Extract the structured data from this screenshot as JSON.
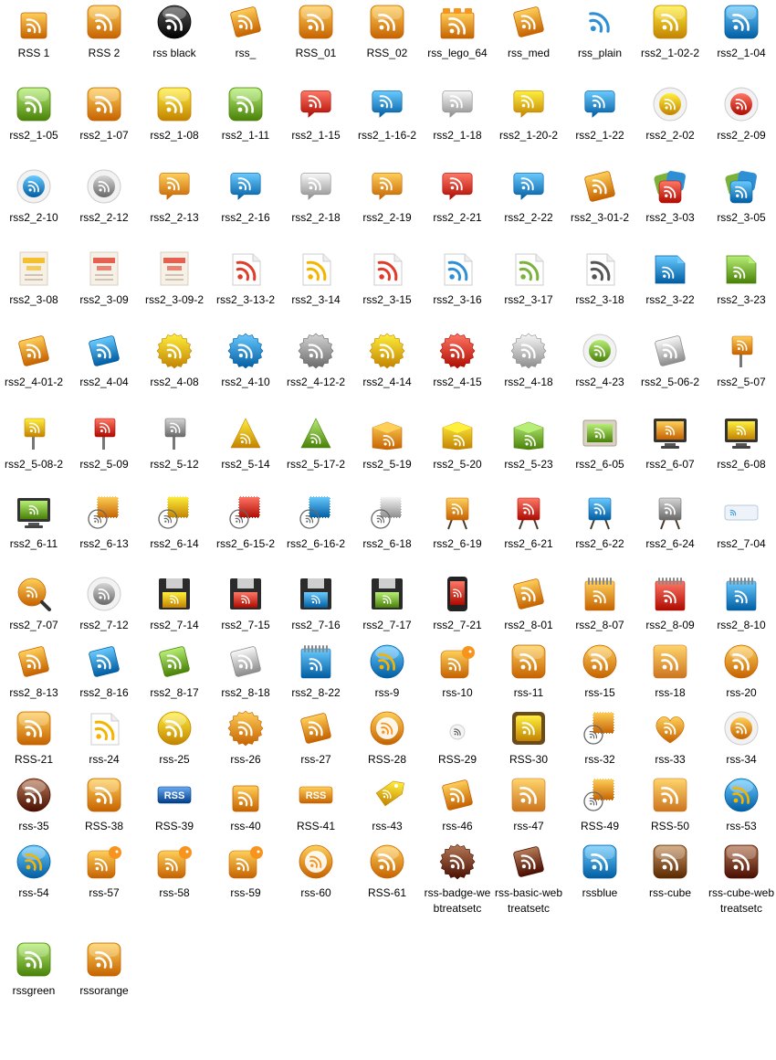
{
  "window": {
    "title": "",
    "view_mode": "large-icons"
  },
  "colors": {
    "rss_orange": "#f7941d",
    "rss_red": "#e03c2a",
    "rss_yellow": "#f4b400",
    "rss_blue": "#2e8fd4",
    "rss_green": "#7bb33a",
    "rss_gray": "#9a9a9a",
    "rss_black": "#1a1a1a",
    "rss_brown": "#7a3f1c",
    "selection_bg": "#cce8ff",
    "label_text": "#000000"
  },
  "rows": [
    [
      {
        "name": "RSS 1",
        "icon": "rss-icon",
        "color": "#f7941d",
        "shape": "square"
      },
      {
        "name": "RSS 2",
        "icon": "rss-icon",
        "color": "#f7941d",
        "shape": "rounded"
      },
      {
        "name": "rss black",
        "icon": "rss-icon",
        "color": "#1a1a1a",
        "shape": "circle"
      },
      {
        "name": "rss_",
        "icon": "rss-icon",
        "color": "#f7941d",
        "shape": "tilted"
      },
      {
        "name": "RSS_01",
        "icon": "rss-icon",
        "color": "#f7941d",
        "shape": "rounded"
      },
      {
        "name": "RSS_02",
        "icon": "rss-icon",
        "color": "#f7941d",
        "shape": "rounded"
      },
      {
        "name": "rss_lego_64",
        "icon": "rss-icon",
        "color": "#f7941d",
        "shape": "lego"
      },
      {
        "name": "rss_med",
        "icon": "rss-icon",
        "color": "#f7941d",
        "shape": "tilted"
      },
      {
        "name": "rss_plain",
        "icon": "rss-icon",
        "color": "#2e8fd4",
        "shape": "plain"
      },
      {
        "name": "rss2_1-02-2",
        "icon": "rss-icon",
        "color": "#f4b400",
        "shape": "rounded"
      },
      {
        "name": "rss2_1-04",
        "icon": "rss-icon",
        "color": "#2e8fd4",
        "shape": "rounded"
      }
    ],
    [
      {
        "name": "rss2_1-05",
        "icon": "rss-icon",
        "color": "#7bb33a",
        "shape": "rounded"
      },
      {
        "name": "rss2_1-07",
        "icon": "rss-icon",
        "color": "#f7941d",
        "shape": "rounded"
      },
      {
        "name": "rss2_1-08",
        "icon": "rss-icon",
        "color": "#f4b400",
        "shape": "rounded"
      },
      {
        "name": "rss2_1-11",
        "icon": "rss-icon",
        "color": "#7bb33a",
        "shape": "rounded"
      },
      {
        "name": "rss2_1-15",
        "icon": "rss-icon",
        "color": "#e03c2a",
        "shape": "bubble"
      },
      {
        "name": "rss2_1-16-2",
        "icon": "rss-icon",
        "color": "#2e8fd4",
        "shape": "bubble"
      },
      {
        "name": "rss2_1-18",
        "icon": "rss-icon",
        "color": "#bdbdbd",
        "shape": "bubble"
      },
      {
        "name": "rss2_1-20-2",
        "icon": "rss-icon",
        "color": "#f4b400",
        "shape": "bubble"
      },
      {
        "name": "rss2_1-22",
        "icon": "rss-icon",
        "color": "#2e8fd4",
        "shape": "bubble"
      },
      {
        "name": "rss2_2-02",
        "icon": "rss-icon",
        "color": "#f4b400",
        "shape": "button"
      },
      {
        "name": "rss2_2-09",
        "icon": "rss-icon",
        "color": "#e03c2a",
        "shape": "button"
      }
    ],
    [
      {
        "name": "rss2_2-10",
        "icon": "rss-icon",
        "color": "#2e8fd4",
        "shape": "button"
      },
      {
        "name": "rss2_2-12",
        "icon": "rss-icon",
        "color": "#9a9a9a",
        "shape": "button"
      },
      {
        "name": "rss2_2-13",
        "icon": "rss-icon",
        "color": "#f7941d",
        "shape": "bubble"
      },
      {
        "name": "rss2_2-16",
        "icon": "rss-icon",
        "color": "#2e8fd4",
        "shape": "bubble"
      },
      {
        "name": "rss2_2-18",
        "icon": "rss-icon",
        "color": "#bdbdbd",
        "shape": "bubble"
      },
      {
        "name": "rss2_2-19",
        "icon": "rss-icon",
        "color": "#f7941d",
        "shape": "bubble"
      },
      {
        "name": "rss2_2-21",
        "icon": "rss-icon",
        "color": "#e03c2a",
        "shape": "bubble"
      },
      {
        "name": "rss2_2-22",
        "icon": "rss-icon",
        "color": "#2e8fd4",
        "shape": "bubble"
      },
      {
        "name": "rss2_3-01-2",
        "icon": "rss-icon",
        "color": "#f7941d",
        "shape": "tilted"
      },
      {
        "name": "rss2_3-03",
        "icon": "rss-icon",
        "color": "#e03c2a",
        "shape": "stack"
      },
      {
        "name": "rss2_3-05",
        "icon": "rss-icon",
        "color": "#2e8fd4",
        "shape": "stack"
      }
    ],
    [
      {
        "name": "rss2_3-08",
        "icon": "rss-icon",
        "color": "#f4b400",
        "shape": "subscribe"
      },
      {
        "name": "rss2_3-09",
        "icon": "rss-icon",
        "color": "#e03c2a",
        "shape": "subscribe"
      },
      {
        "name": "rss2_3-09-2",
        "icon": "rss-icon",
        "color": "#e03c2a",
        "shape": "subscribe"
      },
      {
        "name": "rss2_3-13-2",
        "icon": "rss-icon",
        "color": "#e03c2a",
        "shape": "paper"
      },
      {
        "name": "rss2_3-14",
        "icon": "rss-icon",
        "color": "#f4b400",
        "shape": "paper"
      },
      {
        "name": "rss2_3-15",
        "icon": "rss-icon",
        "color": "#e03c2a",
        "shape": "paper"
      },
      {
        "name": "rss2_3-16",
        "icon": "rss-icon",
        "color": "#2e8fd4",
        "shape": "paper"
      },
      {
        "name": "rss2_3-17",
        "icon": "rss-icon",
        "color": "#7bb33a",
        "shape": "paper"
      },
      {
        "name": "rss2_3-18",
        "icon": "rss-icon",
        "color": "#555555",
        "shape": "paper"
      },
      {
        "name": "rss2_3-22",
        "icon": "rss-icon",
        "color": "#2e8fd4",
        "shape": "page"
      },
      {
        "name": "rss2_3-23",
        "icon": "rss-icon",
        "color": "#7bb33a",
        "shape": "page"
      }
    ],
    [
      {
        "name": "rss2_4-01-2",
        "icon": "rss-icon",
        "color": "#f7941d",
        "shape": "tilted"
      },
      {
        "name": "rss2_4-04",
        "icon": "rss-icon",
        "color": "#2e8fd4",
        "shape": "tilted"
      },
      {
        "name": "rss2_4-08",
        "icon": "rss-icon",
        "color": "#f4b400",
        "shape": "badge"
      },
      {
        "name": "rss2_4-10",
        "icon": "rss-icon",
        "color": "#2e8fd4",
        "shape": "badge"
      },
      {
        "name": "rss2_4-12-2",
        "icon": "rss-icon",
        "color": "#9a9a9a",
        "shape": "badge"
      },
      {
        "name": "rss2_4-14",
        "icon": "rss-icon",
        "color": "#f4b400",
        "shape": "badge"
      },
      {
        "name": "rss2_4-15",
        "icon": "rss-icon",
        "color": "#e03c2a",
        "shape": "badge"
      },
      {
        "name": "rss2_4-18",
        "icon": "rss-icon",
        "color": "#bdbdbd",
        "shape": "badge"
      },
      {
        "name": "rss2_4-23",
        "icon": "rss-icon",
        "color": "#7bb33a",
        "shape": "button"
      },
      {
        "name": "rss2_5-06-2",
        "icon": "rss-icon",
        "color": "#bdbdbd",
        "shape": "tilted"
      },
      {
        "name": "rss2_5-07",
        "icon": "rss-icon",
        "color": "#f7941d",
        "shape": "sign"
      }
    ],
    [
      {
        "name": "rss2_5-08-2",
        "icon": "rss-icon",
        "color": "#f4b400",
        "shape": "sign"
      },
      {
        "name": "rss2_5-09",
        "icon": "rss-icon",
        "color": "#e03c2a",
        "shape": "sign"
      },
      {
        "name": "rss2_5-12",
        "icon": "rss-icon",
        "color": "#9a9a9a",
        "shape": "sign"
      },
      {
        "name": "rss2_5-14",
        "icon": "rss-icon",
        "color": "#f4b400",
        "shape": "tent"
      },
      {
        "name": "rss2_5-17-2",
        "icon": "rss-icon",
        "color": "#7bb33a",
        "shape": "tent"
      },
      {
        "name": "rss2_5-19",
        "icon": "rss-icon",
        "color": "#f7941d",
        "shape": "box"
      },
      {
        "name": "rss2_5-20",
        "icon": "rss-icon",
        "color": "#f4b400",
        "shape": "box"
      },
      {
        "name": "rss2_5-23",
        "icon": "rss-icon",
        "color": "#7bb33a",
        "shape": "box"
      },
      {
        "name": "rss2_6-05",
        "icon": "rss-icon",
        "color": "#7bb33a",
        "shape": "frame"
      },
      {
        "name": "rss2_6-07",
        "icon": "rss-icon",
        "color": "#f7941d",
        "shape": "monitor"
      },
      {
        "name": "rss2_6-08",
        "icon": "rss-icon",
        "color": "#f4b400",
        "shape": "monitor"
      }
    ],
    [
      {
        "name": "rss2_6-11",
        "icon": "rss-icon",
        "color": "#7bb33a",
        "shape": "monitor"
      },
      {
        "name": "rss2_6-13",
        "icon": "rss-icon",
        "color": "#f7941d",
        "shape": "stamp"
      },
      {
        "name": "rss2_6-14",
        "icon": "rss-icon",
        "color": "#f4b400",
        "shape": "stamp"
      },
      {
        "name": "rss2_6-15-2",
        "icon": "rss-icon",
        "color": "#e03c2a",
        "shape": "stamp"
      },
      {
        "name": "rss2_6-16-2",
        "icon": "rss-icon",
        "color": "#2e8fd4",
        "shape": "stamp"
      },
      {
        "name": "rss2_6-18",
        "icon": "rss-icon",
        "color": "#bdbdbd",
        "shape": "stamp"
      },
      {
        "name": "rss2_6-19",
        "icon": "rss-icon",
        "color": "#f7941d",
        "shape": "easel"
      },
      {
        "name": "rss2_6-21",
        "icon": "rss-icon",
        "color": "#e03c2a",
        "shape": "easel"
      },
      {
        "name": "rss2_6-22",
        "icon": "rss-icon",
        "color": "#2e8fd4",
        "shape": "easel"
      },
      {
        "name": "rss2_6-24",
        "icon": "rss-icon",
        "color": "#9a9a9a",
        "shape": "easel"
      },
      {
        "name": "rss2_7-04",
        "icon": "rss-icon",
        "color": "#2e8fd4",
        "shape": "ticket"
      }
    ],
    [
      {
        "name": "rss2_7-07",
        "icon": "rss-icon",
        "color": "#f7941d",
        "shape": "magnifier"
      },
      {
        "name": "rss2_7-12",
        "icon": "rss-icon",
        "color": "#9a9a9a",
        "shape": "button"
      },
      {
        "name": "rss2_7-14",
        "icon": "rss-icon",
        "color": "#f4b400",
        "shape": "floppy"
      },
      {
        "name": "rss2_7-15",
        "icon": "rss-icon",
        "color": "#e03c2a",
        "shape": "floppy"
      },
      {
        "name": "rss2_7-16",
        "icon": "rss-icon",
        "color": "#2e8fd4",
        "shape": "floppy"
      },
      {
        "name": "rss2_7-17",
        "icon": "rss-icon",
        "color": "#7bb33a",
        "shape": "floppy"
      },
      {
        "name": "rss2_7-21",
        "icon": "rss-icon",
        "color": "#e03c2a",
        "shape": "phone"
      },
      {
        "name": "rss2_8-01",
        "icon": "rss-icon",
        "color": "#f7941d",
        "shape": "tilted"
      },
      {
        "name": "rss2_8-07",
        "icon": "rss-icon",
        "color": "#f7941d",
        "shape": "notepad"
      },
      {
        "name": "rss2_8-09",
        "icon": "rss-icon",
        "color": "#e03c2a",
        "shape": "notepad"
      },
      {
        "name": "rss2_8-10",
        "icon": "rss-icon",
        "color": "#2e8fd4",
        "shape": "notepad"
      }
    ],
    [
      {
        "name": "rss2_8-13",
        "icon": "rss-icon",
        "color": "#f7941d",
        "shape": "tilted"
      },
      {
        "name": "rss2_8-16",
        "icon": "rss-icon",
        "color": "#2e8fd4",
        "shape": "tilted"
      },
      {
        "name": "rss2_8-17",
        "icon": "rss-icon",
        "color": "#7bb33a",
        "shape": "tilted"
      },
      {
        "name": "rss2_8-18",
        "icon": "rss-icon",
        "color": "#bdbdbd",
        "shape": "tilted"
      },
      {
        "name": "rss2_8-22",
        "icon": "rss-icon",
        "color": "#2e8fd4",
        "shape": "notepad"
      },
      {
        "name": "rss-9",
        "icon": "rss-icon",
        "color": "#2e8fd4",
        "shape": "globe"
      },
      {
        "name": "rss-10",
        "icon": "rss-icon",
        "color": "#f7941d",
        "shape": "bird"
      },
      {
        "name": "rss-11",
        "icon": "rss-icon",
        "color": "#f7941d",
        "shape": "rounded"
      },
      {
        "name": "rss-15",
        "icon": "rss-icon",
        "color": "#f7941d",
        "shape": "circle"
      },
      {
        "name": "rss-18",
        "icon": "rss-icon",
        "color": "#f7941d",
        "shape": "grunge"
      },
      {
        "name": "rss-20",
        "icon": "rss-icon",
        "color": "#f7941d",
        "shape": "circle"
      }
    ],
    [
      {
        "name": "RSS-21",
        "icon": "rss-icon",
        "color": "#f7941d",
        "shape": "rounded"
      },
      {
        "name": "rss-24",
        "icon": "rss-icon",
        "color": "#f4b400",
        "shape": "paper"
      },
      {
        "name": "rss-25",
        "icon": "rss-icon",
        "color": "#f4b400",
        "shape": "circle"
      },
      {
        "name": "rss-26",
        "icon": "rss-icon",
        "color": "#f7941d",
        "shape": "badge"
      },
      {
        "name": "rss-27",
        "icon": "rss-icon",
        "color": "#f7941d",
        "shape": "tilted"
      },
      {
        "name": "RSS-28",
        "icon": "rss-icon",
        "color": "#f7941d",
        "shape": "ring"
      },
      {
        "name": "RSS-29",
        "icon": "rss-icon",
        "color": "#555555",
        "shape": "small"
      },
      {
        "name": "RSS-30",
        "icon": "rss-icon",
        "color": "#f4b400",
        "shape": "framed"
      },
      {
        "name": "rss-32",
        "icon": "rss-icon",
        "color": "#f7941d",
        "shape": "stamp"
      },
      {
        "name": "rss-33",
        "icon": "rss-icon",
        "color": "#f7941d",
        "shape": "heart"
      },
      {
        "name": "rss-34",
        "icon": "rss-icon",
        "color": "#f7941d",
        "shape": "button"
      }
    ],
    [
      {
        "name": "rss-35",
        "icon": "rss-icon",
        "color": "#7a3f1c",
        "shape": "circle"
      },
      {
        "name": "RSS-38",
        "icon": "rss-icon",
        "color": "#f7941d",
        "shape": "rounded"
      },
      {
        "name": "RSS-39",
        "icon": "rss-icon",
        "color": "#2e6fb8",
        "shape": "textbutton",
        "text": "RSS"
      },
      {
        "name": "rss-40",
        "icon": "rss-icon",
        "color": "#f7941d",
        "shape": "square"
      },
      {
        "name": "RSS-41",
        "icon": "rss-icon",
        "color": "#f7941d",
        "shape": "textbutton",
        "text": "RSS"
      },
      {
        "name": "rss-43",
        "icon": "rss-icon",
        "color": "#f4b400",
        "shape": "tag"
      },
      {
        "name": "rss-46",
        "icon": "rss-icon",
        "color": "#f7941d",
        "shape": "tilted"
      },
      {
        "name": "rss-47",
        "icon": "rss-icon",
        "color": "#f7941d",
        "shape": "grunge"
      },
      {
        "name": "RSS-49",
        "icon": "rss-icon",
        "color": "#f7941d",
        "shape": "stamp"
      },
      {
        "name": "RSS-50",
        "icon": "rss-icon",
        "color": "#f7941d",
        "shape": "grunge"
      },
      {
        "name": "rss-53",
        "icon": "rss-icon",
        "color": "#2e8fd4",
        "shape": "globe"
      }
    ],
    [
      {
        "name": "rss-54",
        "icon": "rss-icon",
        "color": "#2e8fd4",
        "shape": "globe"
      },
      {
        "name": "rss-57",
        "icon": "rss-icon",
        "color": "#f7941d",
        "shape": "bird"
      },
      {
        "name": "rss-58",
        "icon": "rss-icon",
        "color": "#f7941d",
        "shape": "bird"
      },
      {
        "name": "rss-59",
        "icon": "rss-icon",
        "color": "#f7941d",
        "shape": "bird"
      },
      {
        "name": "rss-60",
        "icon": "rss-icon",
        "color": "#f7941d",
        "shape": "ring"
      },
      {
        "name": "RSS-61",
        "icon": "rss-icon",
        "color": "#f7941d",
        "shape": "circle"
      },
      {
        "name": "rss-badge-webtreatsetc",
        "icon": "rss-icon",
        "color": "#7a3f1c",
        "shape": "badge"
      },
      {
        "name": "rss-basic-webtreatsetc",
        "icon": "rss-icon",
        "color": "#7a3f1c",
        "shape": "tilted"
      },
      {
        "name": "rssblue",
        "icon": "rss-icon",
        "color": "#2e8fd4",
        "shape": "rounded"
      },
      {
        "name": "rss-cube",
        "icon": "rss-icon",
        "color": "#8b5a2b",
        "shape": "rounded"
      },
      {
        "name": "rss-cube-webtreatsetc",
        "icon": "rss-icon",
        "color": "#7a3f1c",
        "shape": "rounded"
      }
    ],
    [
      {
        "name": "rssgreen",
        "icon": "rss-icon",
        "color": "#7bb33a",
        "shape": "rounded"
      },
      {
        "name": "rssorange",
        "icon": "rss-icon",
        "color": "#f7941d",
        "shape": "rounded"
      }
    ]
  ]
}
